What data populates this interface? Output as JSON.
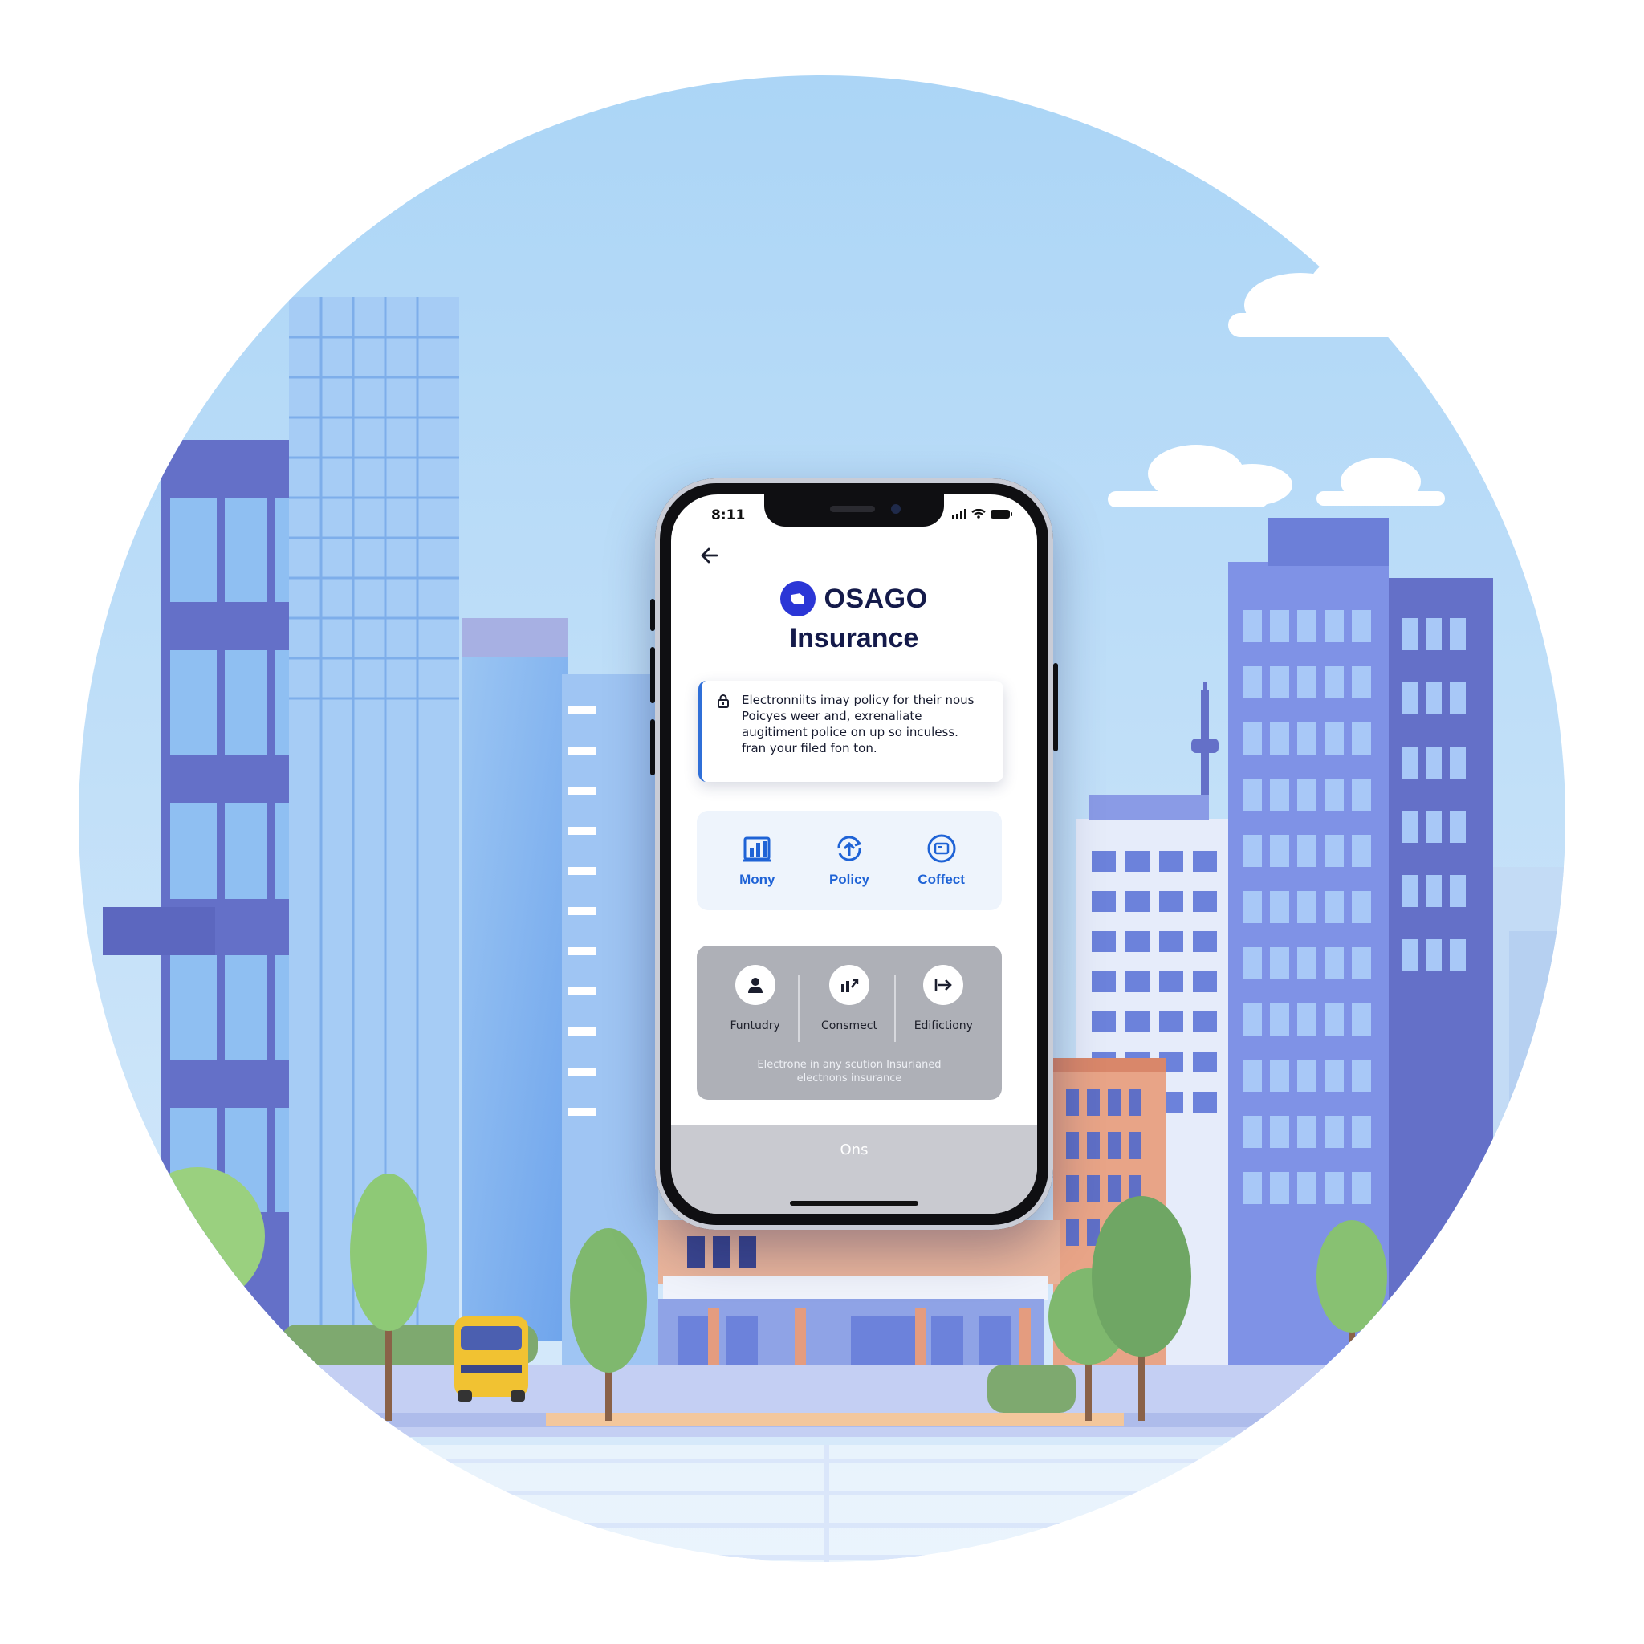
{
  "status_bar": {
    "time": "8:11"
  },
  "app": {
    "brand": "OSAGO",
    "title": "Insurance"
  },
  "info_card": {
    "lines": [
      "Electronniits imay policy for  their nous",
      "Poicyes weer and, exrenaliate",
      "augitiment police on up so inculess.",
      "fran your filed fon ton."
    ]
  },
  "quick_actions": [
    {
      "label": "Mony",
      "icon": "document-chart-icon"
    },
    {
      "label": "Policy",
      "icon": "sync-upload-icon"
    },
    {
      "label": "Coffect",
      "icon": "ticket-icon"
    }
  ],
  "services": {
    "items": [
      {
        "label": "Funtudry",
        "icon": "user-icon"
      },
      {
        "label": "Consmect",
        "icon": "chart-icon"
      },
      {
        "label": "Edifictiony",
        "icon": "arrow-right-bar-icon"
      }
    ],
    "caption_lines": [
      "Electrone in any scution Insurianed",
      "electnons insurance"
    ]
  },
  "bottom_button": {
    "label": "Ons"
  },
  "colors": {
    "brand_blue": "#2b36d6",
    "accent_blue": "#1f63d6",
    "sky": "#b5daf7",
    "building_purple": "#6470c8"
  }
}
